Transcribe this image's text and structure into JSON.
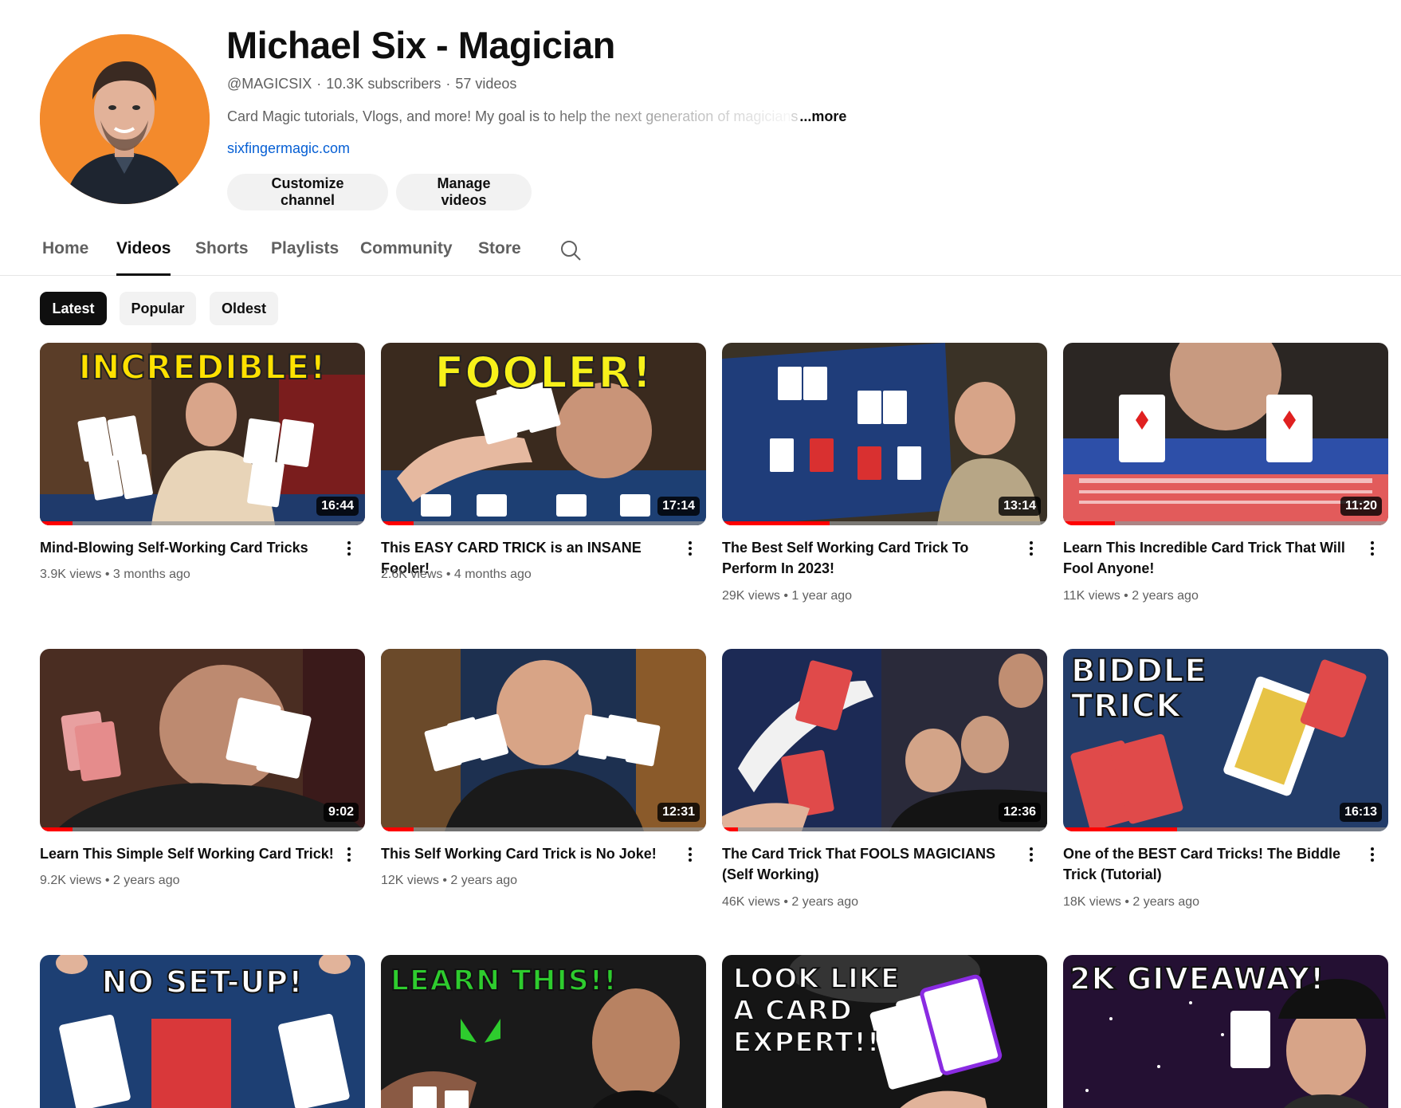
{
  "channel": {
    "name": "Michael Six - Magician",
    "handle": "@MAGICSIX",
    "subscribers": "10.3K subscribers",
    "videos_count": "57 videos",
    "description": "Card Magic tutorials, Vlogs, and more! My goal is to help the next generation of magician",
    "description_fade": "s",
    "more_label": "...more",
    "link": "sixfingermagic.com",
    "buttons": {
      "customize": "Customize channel",
      "manage": "Manage videos"
    }
  },
  "tabs": [
    {
      "label": "Home"
    },
    {
      "label": "Videos",
      "active": true
    },
    {
      "label": "Shorts"
    },
    {
      "label": "Playlists"
    },
    {
      "label": "Community"
    },
    {
      "label": "Store"
    }
  ],
  "search_icon": "search-icon",
  "filters": [
    {
      "label": "Latest",
      "active": true
    },
    {
      "label": "Popular"
    },
    {
      "label": "Oldest"
    }
  ],
  "videos": [
    {
      "title": "Mind-Blowing Self-Working Card Tricks",
      "views": "3.9K views",
      "age": "3 months ago",
      "duration": "16:44",
      "watched": 0.1,
      "thumb_text": "INCREDIBLE!"
    },
    {
      "title": "This EASY CARD TRICK is an INSANE Fooler!",
      "views": "2.6K views",
      "age": "4 months ago",
      "duration": "17:14",
      "watched": 0.1,
      "thumb_text": "FOOLER!"
    },
    {
      "title": "The Best Self Working Card Trick To Perform In 2023!",
      "views": "29K views",
      "age": "1 year ago",
      "duration": "13:14",
      "watched": 0.33,
      "thumb_text": ""
    },
    {
      "title": "Learn This Incredible Card Trick That Will Fool Anyone!",
      "views": "11K views",
      "age": "2 years ago",
      "duration": "11:20",
      "watched": 0.16,
      "thumb_text": ""
    },
    {
      "title": "Learn This Simple Self Working Card Trick!",
      "views": "9.2K views",
      "age": "2 years ago",
      "duration": "9:02",
      "watched": 0.1,
      "thumb_text": ""
    },
    {
      "title": "This Self Working Card Trick is No Joke!",
      "views": "12K views",
      "age": "2 years ago",
      "duration": "12:31",
      "watched": 0.1,
      "thumb_text": ""
    },
    {
      "title": "The Card Trick That FOOLS MAGICIANS (Self Working)",
      "views": "46K views",
      "age": "2 years ago",
      "duration": "12:36",
      "watched": 0.05,
      "thumb_text": ""
    },
    {
      "title": "One of the BEST Card Tricks! The Biddle Trick (Tutorial)",
      "views": "18K views",
      "age": "2 years ago",
      "duration": "16:13",
      "watched": 0.35,
      "thumb_text": "BIDDLE TRICK"
    },
    {
      "title": "",
      "views": "",
      "age": "",
      "duration": "",
      "watched": 0,
      "thumb_text": "NO SET-UP!"
    },
    {
      "title": "",
      "views": "",
      "age": "",
      "duration": "",
      "watched": 0,
      "thumb_text": "LEARN THIS!!"
    },
    {
      "title": "",
      "views": "",
      "age": "",
      "duration": "",
      "watched": 0,
      "thumb_text": "LOOK LIKE A CARD EXPERT!!"
    },
    {
      "title": "",
      "views": "",
      "age": "",
      "duration": "",
      "watched": 0,
      "thumb_text": "2K GIVEAWAY!"
    }
  ],
  "colors": {
    "accent_red": "#ff0000",
    "link_blue": "#065fd4",
    "avatar_bg": "#f38a2c",
    "secondary_text": "#606060"
  }
}
